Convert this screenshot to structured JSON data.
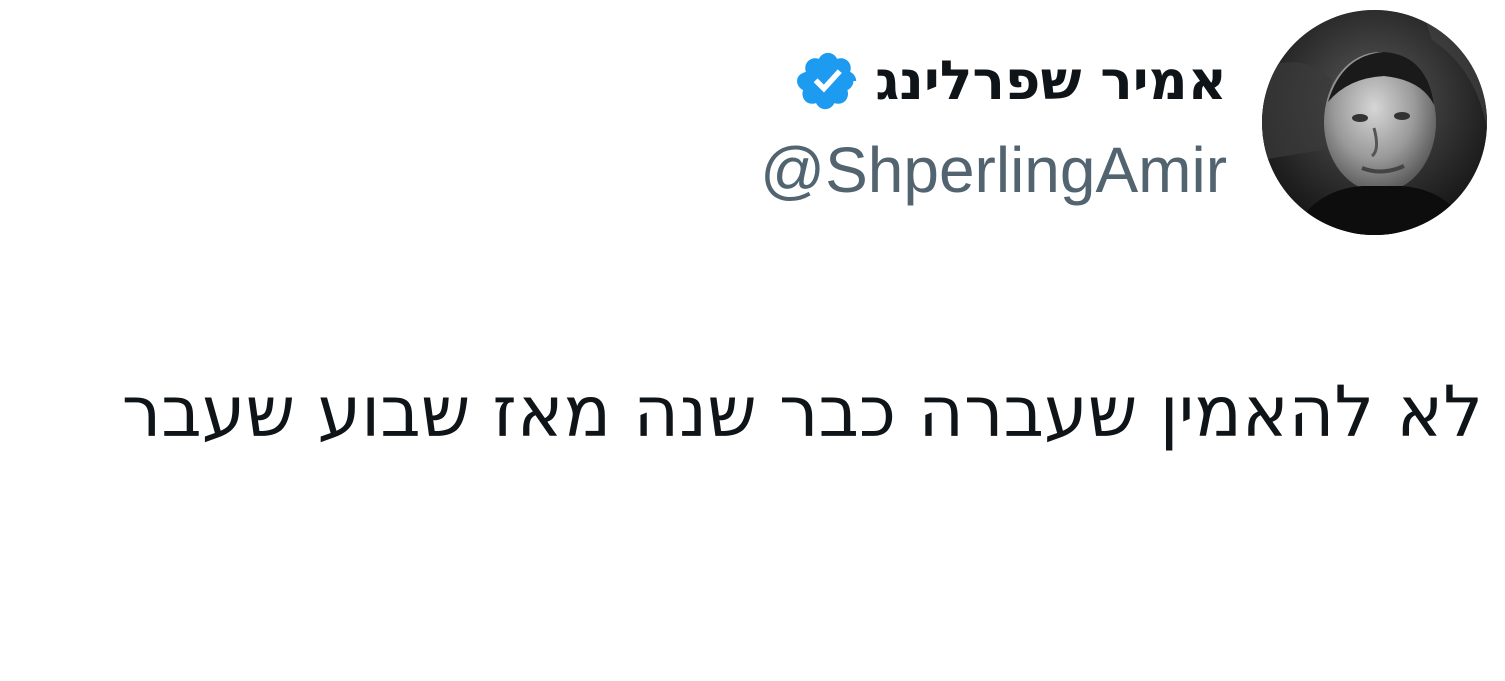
{
  "tweet": {
    "author": {
      "display_name": "אמיר שפרלינג",
      "handle": "@ShperlingAmir",
      "verified": true,
      "verified_icon": "verified-badge-icon",
      "avatar_icon": "profile-photo"
    },
    "text": "לא להאמין שעברה כבר שנה מאז שבוע שעבר"
  },
  "colors": {
    "verified_badge": "#1d9bf0",
    "handle_text": "#536471",
    "body_text": "#0f1419",
    "background": "#ffffff"
  }
}
